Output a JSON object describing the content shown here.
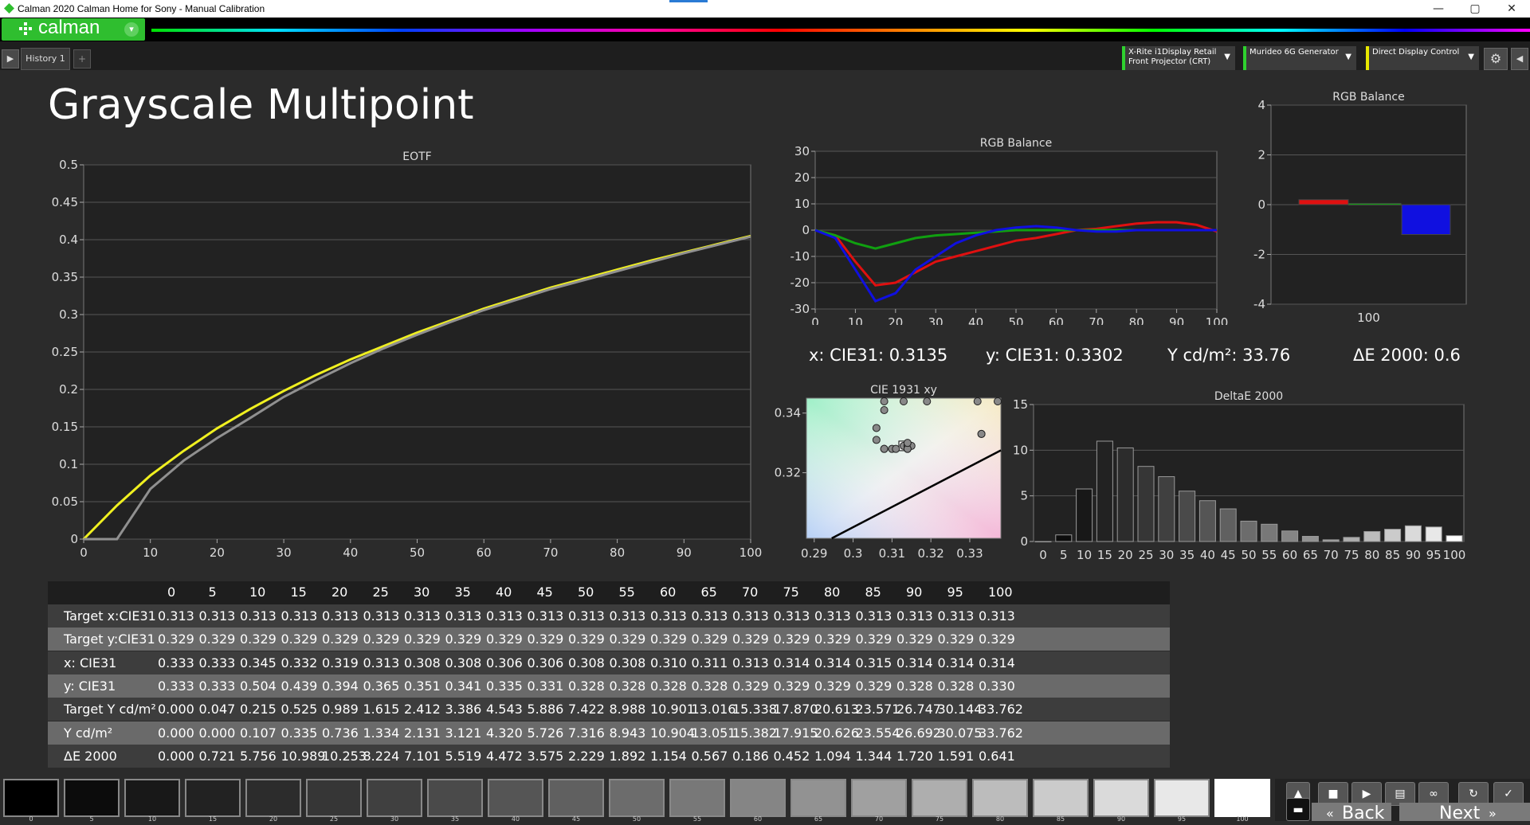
{
  "window": {
    "title": "Calman 2020 Calman Home for Sony  - Manual Calibration",
    "min": "—",
    "max": "▢",
    "close": "✕"
  },
  "logo": {
    "text": "calman",
    "dd": "▾"
  },
  "tabs": {
    "play": "▶",
    "history": "History 1",
    "add": "+"
  },
  "devices": [
    {
      "line1": "X-Rite i1Display Retail",
      "line2": "Front Projector (CRT)",
      "color": "#2fd12f"
    },
    {
      "line1": "Murideo 6G Generator",
      "line2": "",
      "color": "#2fd12f"
    },
    {
      "line1": "Direct Display Control",
      "line2": "",
      "color": "#e8e800"
    }
  ],
  "page": {
    "title": "Grayscale Multipoint"
  },
  "readouts": {
    "x": "x: CIE31: 0.3135",
    "y": "y: CIE31: 0.3302",
    "Y": "Y cd/m²: 33.76",
    "de": "ΔE 2000: 0.6"
  },
  "chart_data": [
    {
      "type": "line",
      "title": "EOTF",
      "x": [
        0,
        5,
        10,
        15,
        20,
        25,
        30,
        35,
        40,
        45,
        50,
        55,
        60,
        65,
        70,
        75,
        80,
        85,
        90,
        95,
        100
      ],
      "xlim": [
        0,
        100
      ],
      "ylim": [
        0,
        0.5
      ],
      "xticks": [
        "0",
        "10",
        "20",
        "30",
        "40",
        "50",
        "60",
        "70",
        "80",
        "90",
        "100"
      ],
      "yticks": [
        "0",
        "0.05",
        "0.1",
        "0.15",
        "0.2",
        "0.25",
        "0.3",
        "0.35",
        "0.4",
        "0.45",
        "0.5"
      ],
      "series": [
        {
          "color": "#f0f020",
          "values": [
            0,
            0.045,
            0.085,
            0.118,
            0.148,
            0.174,
            0.198,
            0.22,
            0.24,
            0.258,
            0.276,
            0.292,
            0.308,
            0.322,
            0.336,
            0.348,
            0.36,
            0.372,
            0.383,
            0.394,
            0.405
          ]
        },
        {
          "color": "#909090",
          "values": [
            0,
            0,
            0.067,
            0.105,
            0.135,
            0.162,
            0.19,
            0.213,
            0.235,
            0.255,
            0.273,
            0.29,
            0.306,
            0.32,
            0.334,
            0.346,
            0.358,
            0.37,
            0.382,
            0.393,
            0.404
          ]
        }
      ]
    },
    {
      "type": "line",
      "title": "RGB Balance",
      "x": [
        0,
        5,
        10,
        15,
        20,
        25,
        30,
        35,
        40,
        45,
        50,
        55,
        60,
        65,
        70,
        75,
        80,
        85,
        90,
        95,
        100
      ],
      "xlim": [
        0,
        100
      ],
      "ylim": [
        -30,
        30
      ],
      "xticks": [
        "0",
        "10",
        "20",
        "30",
        "40",
        "50",
        "60",
        "70",
        "80",
        "90",
        "100"
      ],
      "yticks": [
        "-30",
        "-20",
        "-10",
        "0",
        "10",
        "20",
        "30"
      ],
      "series": [
        {
          "color": "#e01010",
          "values": [
            0,
            -2,
            -12,
            -21,
            -20,
            -16,
            -12,
            -10,
            -8,
            -6,
            -4,
            -3,
            -1.5,
            0,
            0.5,
            1.5,
            2.5,
            3,
            3,
            2,
            -0.5
          ]
        },
        {
          "color": "#10a010",
          "values": [
            0,
            -2,
            -5,
            -7,
            -5,
            -3,
            -2,
            -1.5,
            -1,
            -0.5,
            0,
            0,
            0,
            0,
            0,
            0,
            0,
            0,
            0,
            0,
            0
          ]
        },
        {
          "color": "#1010e0",
          "values": [
            0,
            -3,
            -15,
            -27,
            -24,
            -15,
            -10,
            -5,
            -2,
            0,
            1,
            1.5,
            1,
            0,
            -0.5,
            -0.5,
            0,
            0,
            0,
            0,
            0
          ]
        }
      ]
    },
    {
      "type": "bar",
      "title": "RGB Balance",
      "categories": [
        "100"
      ],
      "ylim": [
        -4,
        4
      ],
      "yticks": [
        "-4",
        "-2",
        "0",
        "2",
        "4"
      ],
      "series": [
        {
          "color": "#e01010",
          "values": [
            0.2
          ]
        },
        {
          "color": "#10a010",
          "values": [
            0.05
          ]
        },
        {
          "color": "#1010e0",
          "values": [
            -1.2
          ]
        }
      ]
    },
    {
      "type": "scatter",
      "title": "CIE 1931 xy",
      "xlim": [
        0.288,
        0.338
      ],
      "ylim": [
        0.298,
        0.345
      ],
      "xticks": [
        "0.29",
        "0.3",
        "0.31",
        "0.32",
        "0.33"
      ],
      "yticks": [
        "0.32",
        "0.34"
      ],
      "points": [
        [
          0.333,
          0.333
        ],
        [
          0.333,
          0.333
        ],
        [
          0.345,
          0.504
        ],
        [
          0.332,
          0.439
        ],
        [
          0.319,
          0.394
        ],
        [
          0.313,
          0.365
        ],
        [
          0.308,
          0.351
        ],
        [
          0.308,
          0.341
        ],
        [
          0.306,
          0.335
        ],
        [
          0.306,
          0.331
        ],
        [
          0.308,
          0.328
        ],
        [
          0.308,
          0.328
        ],
        [
          0.31,
          0.328
        ],
        [
          0.311,
          0.328
        ],
        [
          0.313,
          0.329
        ],
        [
          0.314,
          0.329
        ],
        [
          0.314,
          0.329
        ],
        [
          0.315,
          0.329
        ],
        [
          0.314,
          0.328
        ],
        [
          0.314,
          0.328
        ],
        [
          0.314,
          0.33
        ]
      ]
    },
    {
      "type": "bar",
      "title": "DeltaE 2000",
      "categories": [
        "0",
        "5",
        "10",
        "15",
        "20",
        "25",
        "30",
        "35",
        "40",
        "45",
        "50",
        "55",
        "60",
        "65",
        "70",
        "75",
        "80",
        "85",
        "90",
        "95",
        "100"
      ],
      "values": [
        0.0,
        0.721,
        5.756,
        10.989,
        10.253,
        8.224,
        7.101,
        5.519,
        4.472,
        3.575,
        2.229,
        1.892,
        1.154,
        0.567,
        0.186,
        0.452,
        1.094,
        1.344,
        1.72,
        1.591,
        0.641
      ],
      "ylim": [
        0,
        15
      ],
      "yticks": [
        "0",
        "5",
        "10",
        "15"
      ]
    }
  ],
  "table": {
    "columns": [
      "0",
      "5",
      "10",
      "15",
      "20",
      "25",
      "30",
      "35",
      "40",
      "45",
      "50",
      "55",
      "60",
      "65",
      "70",
      "75",
      "80",
      "85",
      "90",
      "95",
      "100"
    ],
    "rows": [
      {
        "label": "Target x:CIE31",
        "values": [
          "0.313",
          "0.313",
          "0.313",
          "0.313",
          "0.313",
          "0.313",
          "0.313",
          "0.313",
          "0.313",
          "0.313",
          "0.313",
          "0.313",
          "0.313",
          "0.313",
          "0.313",
          "0.313",
          "0.313",
          "0.313",
          "0.313",
          "0.313",
          "0.313"
        ]
      },
      {
        "label": "Target y:CIE31",
        "values": [
          "0.329",
          "0.329",
          "0.329",
          "0.329",
          "0.329",
          "0.329",
          "0.329",
          "0.329",
          "0.329",
          "0.329",
          "0.329",
          "0.329",
          "0.329",
          "0.329",
          "0.329",
          "0.329",
          "0.329",
          "0.329",
          "0.329",
          "0.329",
          "0.329"
        ]
      },
      {
        "label": "x: CIE31",
        "values": [
          "0.333",
          "0.333",
          "0.345",
          "0.332",
          "0.319",
          "0.313",
          "0.308",
          "0.308",
          "0.306",
          "0.306",
          "0.308",
          "0.308",
          "0.310",
          "0.311",
          "0.313",
          "0.314",
          "0.314",
          "0.315",
          "0.314",
          "0.314",
          "0.314"
        ]
      },
      {
        "label": "y: CIE31",
        "values": [
          "0.333",
          "0.333",
          "0.504",
          "0.439",
          "0.394",
          "0.365",
          "0.351",
          "0.341",
          "0.335",
          "0.331",
          "0.328",
          "0.328",
          "0.328",
          "0.328",
          "0.329",
          "0.329",
          "0.329",
          "0.329",
          "0.328",
          "0.328",
          "0.330"
        ]
      },
      {
        "label": "Target Y cd/m²",
        "values": [
          "0.000",
          "0.047",
          "0.215",
          "0.525",
          "0.989",
          "1.615",
          "2.412",
          "3.386",
          "4.543",
          "5.886",
          "7.422",
          "8.988",
          "10.901",
          "13.016",
          "15.338",
          "17.870",
          "20.613",
          "23.571",
          "26.747",
          "30.144",
          "33.762"
        ]
      },
      {
        "label": "Y cd/m²",
        "values": [
          "0.000",
          "0.000",
          "0.107",
          "0.335",
          "0.736",
          "1.334",
          "2.131",
          "3.121",
          "4.320",
          "5.726",
          "7.316",
          "8.943",
          "10.904",
          "13.051",
          "15.382",
          "17.915",
          "20.626",
          "23.554",
          "26.692",
          "30.075",
          "33.762"
        ]
      },
      {
        "label": "ΔE 2000",
        "values": [
          "0.000",
          "0.721",
          "5.756",
          "10.989",
          "10.253",
          "8.224",
          "7.101",
          "5.519",
          "4.472",
          "3.575",
          "2.229",
          "1.892",
          "1.154",
          "0.567",
          "0.186",
          "0.452",
          "1.094",
          "1.344",
          "1.720",
          "1.591",
          "0.641"
        ]
      }
    ]
  },
  "swatches": {
    "labels": [
      "0",
      "5",
      "10",
      "15",
      "20",
      "25",
      "30",
      "35",
      "40",
      "45",
      "50",
      "55",
      "60",
      "65",
      "70",
      "75",
      "80",
      "85",
      "90",
      "95",
      "100"
    ],
    "colors": [
      "#000000",
      "#0c0c0c",
      "#181818",
      "#222222",
      "#2c2c2c",
      "#363636",
      "#404040",
      "#4a4a4a",
      "#555555",
      "#606060",
      "#6c6c6c",
      "#787878",
      "#858585",
      "#929292",
      "#a0a0a0",
      "#aeaeae",
      "#bcbcbc",
      "#cbcbcb",
      "#dadada",
      "#e8e8e8",
      "#ffffff"
    ],
    "selected": "100"
  },
  "controls": {
    "back": "Back",
    "next": "Next"
  }
}
